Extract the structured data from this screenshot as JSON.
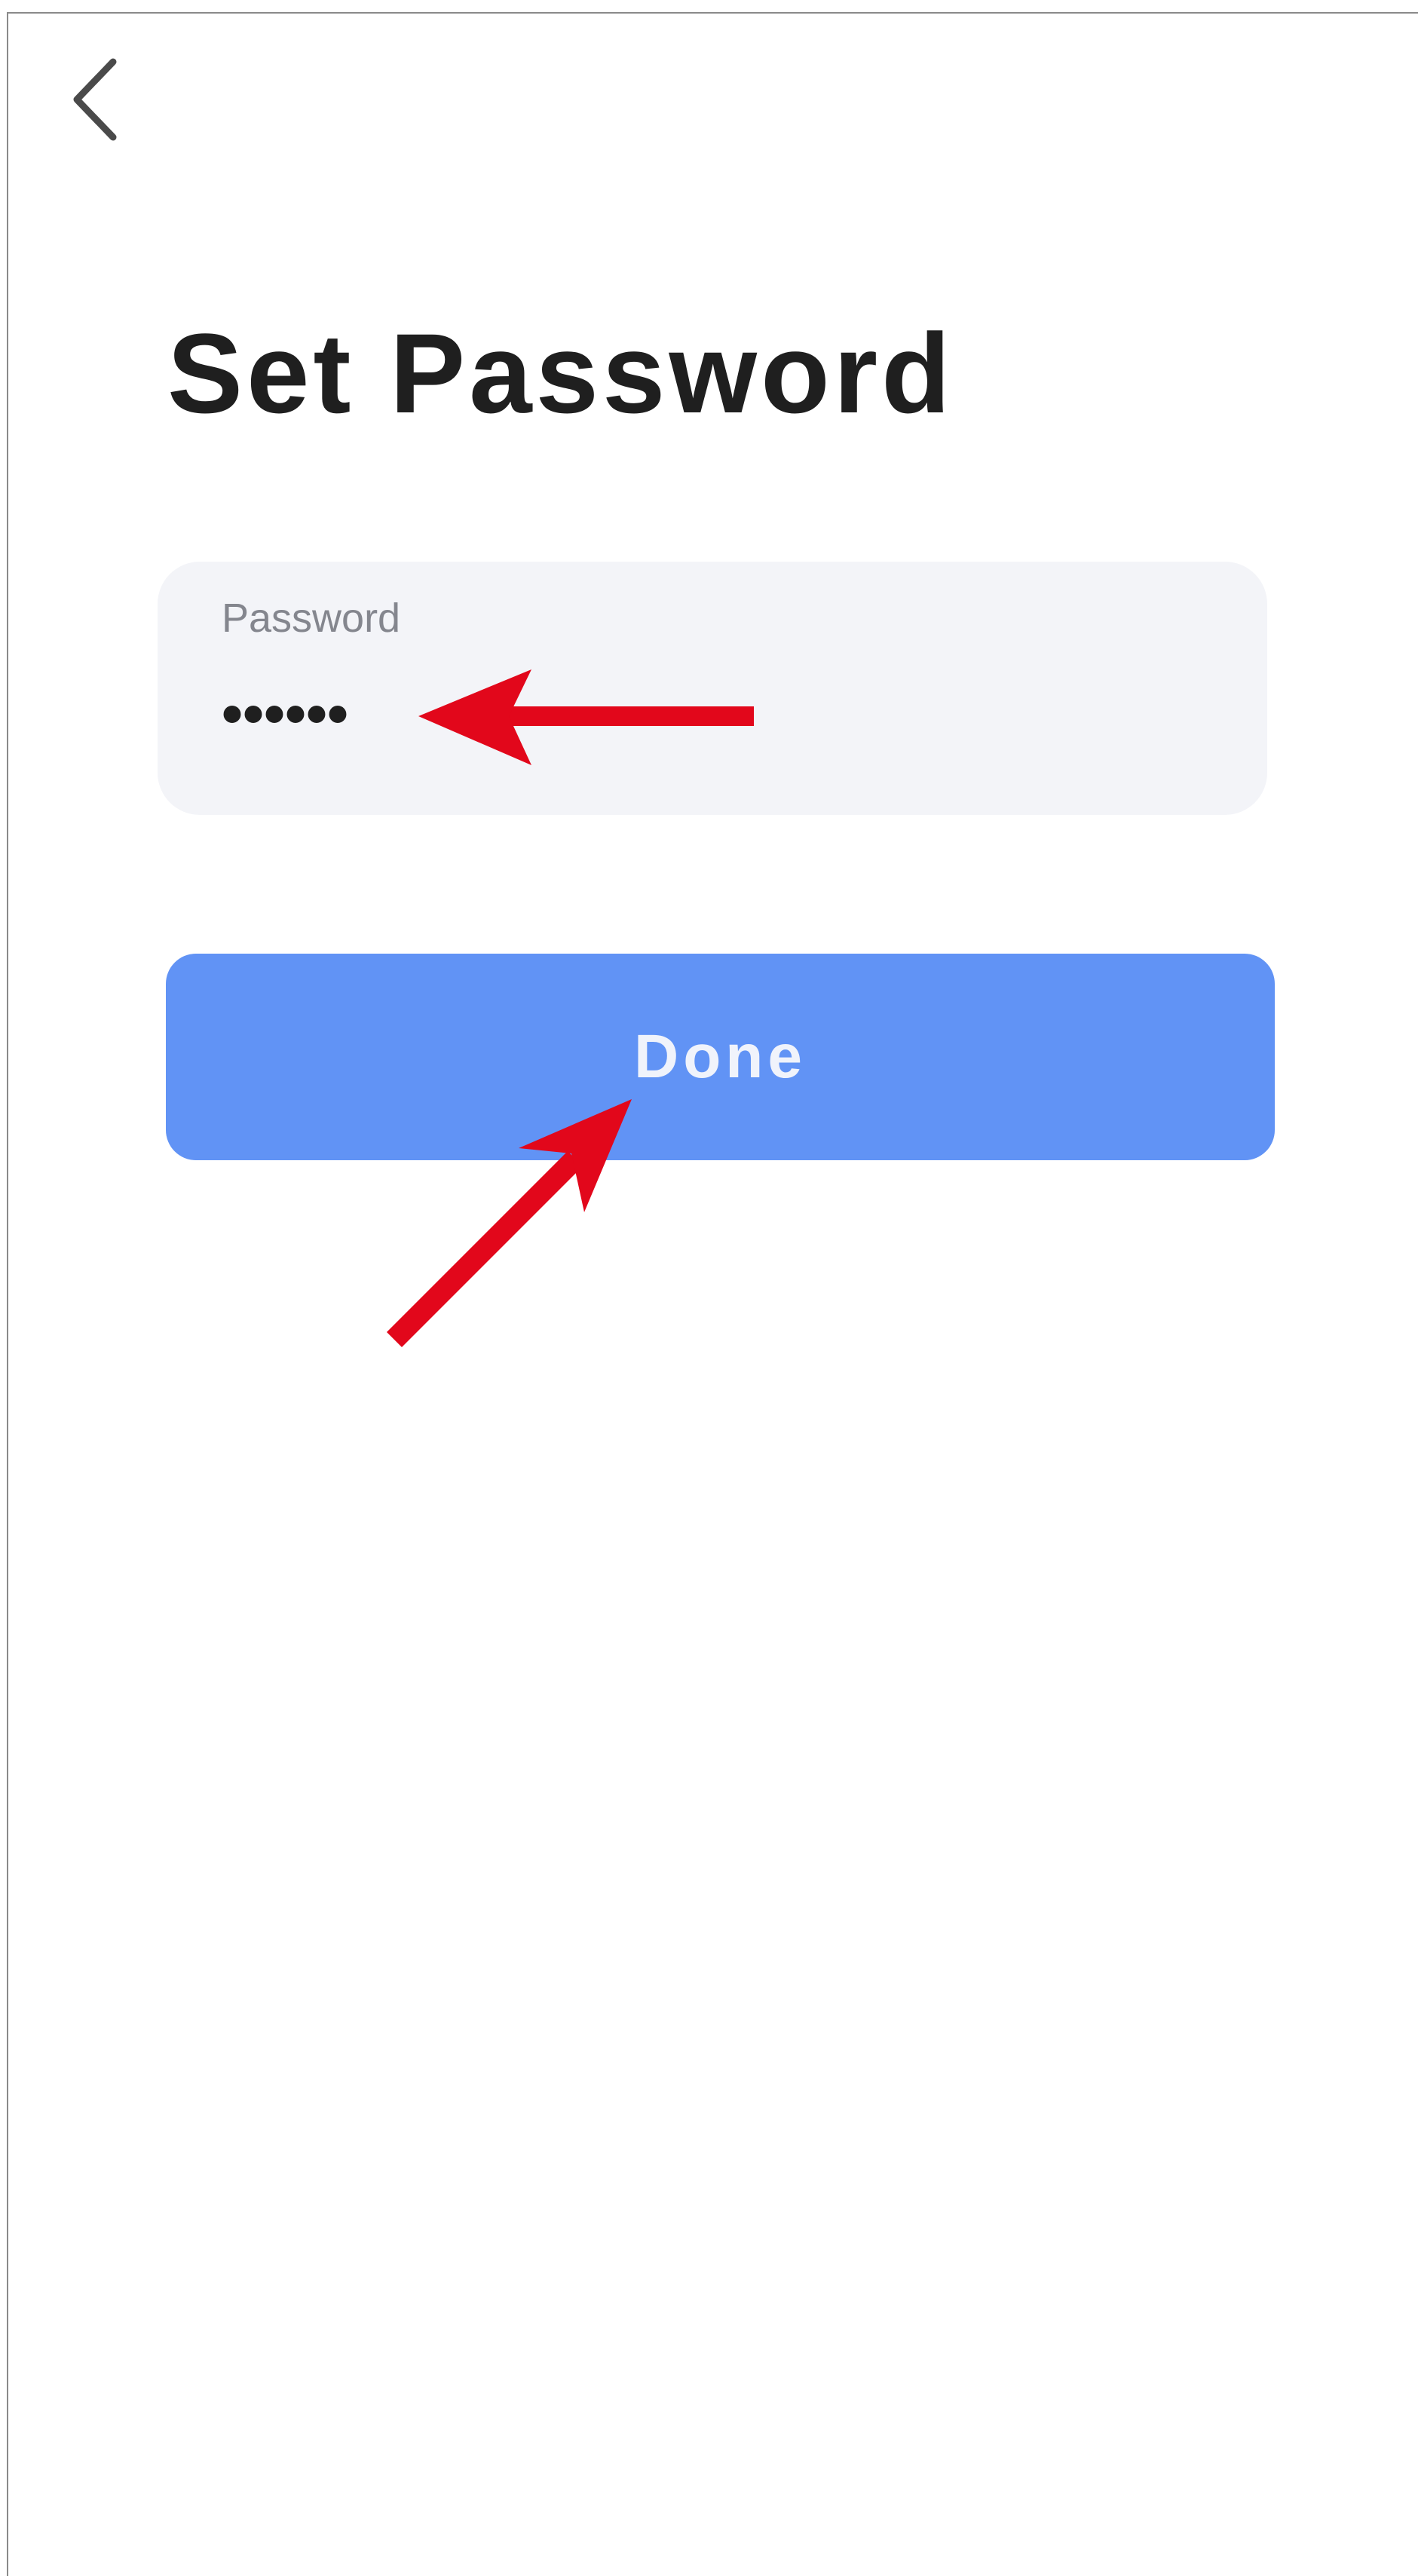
{
  "screen": {
    "title": "Set Password"
  },
  "nav": {
    "back_icon": "chevron-left-icon"
  },
  "password_field": {
    "label": "Password",
    "value": "••••••"
  },
  "actions": {
    "done_label": "Done"
  },
  "annotations": {
    "color": "#e2071b",
    "arrows": [
      {
        "name": "annotation-arrow-password",
        "points_to": "password_field"
      },
      {
        "name": "annotation-arrow-done",
        "points_to": "done_button"
      }
    ]
  },
  "theme": {
    "primary": "#6193f5",
    "field_background": "#f3f4f8",
    "text_dark": "#1f1f1f",
    "text_muted": "#84868e"
  }
}
